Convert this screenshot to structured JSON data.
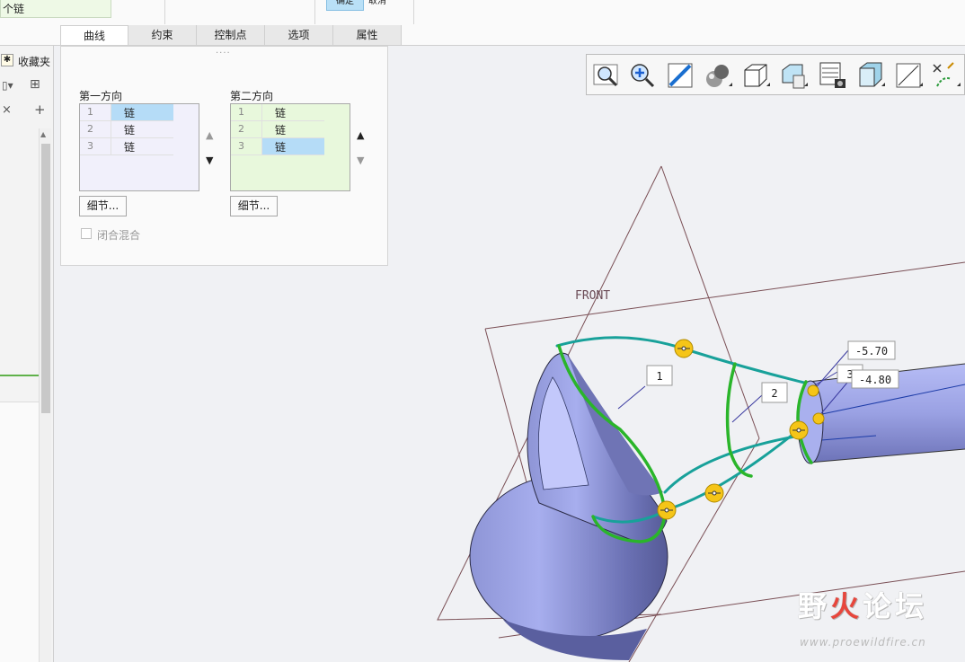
{
  "top": {
    "chain_stub": "个链",
    "ok_label": "确定",
    "cancel_label": "取消"
  },
  "tabs": [
    {
      "label": "曲线",
      "active": true
    },
    {
      "label": "约束",
      "active": false
    },
    {
      "label": "控制点",
      "active": false
    },
    {
      "label": "选项",
      "active": false
    },
    {
      "label": "属性",
      "active": false
    }
  ],
  "left_strip": {
    "favorites": "收藏夹"
  },
  "panel": {
    "grip": "····",
    "dir1": {
      "label": "第一方向",
      "rows": [
        {
          "num": "1",
          "value": "链",
          "selected": true
        },
        {
          "num": "2",
          "value": "链",
          "selected": false
        },
        {
          "num": "3",
          "value": "链",
          "selected": false
        }
      ],
      "detail": "细节..."
    },
    "dir2": {
      "label": "第二方向",
      "rows": [
        {
          "num": "1",
          "value": "链",
          "selected": false
        },
        {
          "num": "2",
          "value": "链",
          "selected": false
        },
        {
          "num": "3",
          "value": "链",
          "selected": true
        }
      ],
      "detail": "细节..."
    },
    "close_blend": "闭合混合"
  },
  "viewport": {
    "plane_label": "FRONT",
    "callouts": [
      "1",
      "2",
      "3"
    ],
    "dim1": "-5.70",
    "dim2": "-4.80"
  },
  "toolbar": {
    "icons": [
      "zoom-fit-icon",
      "zoom-in-icon",
      "reorient-icon",
      "shading-icon",
      "display-style-icon",
      "saved-views-icon",
      "view-manager-icon",
      "section-icon",
      "perspective-icon",
      "datum-display-icon"
    ]
  },
  "watermark": {
    "title_a": "野",
    "title_fire": "火",
    "title_b": "论坛",
    "url": "www.proewildfire.cn"
  }
}
